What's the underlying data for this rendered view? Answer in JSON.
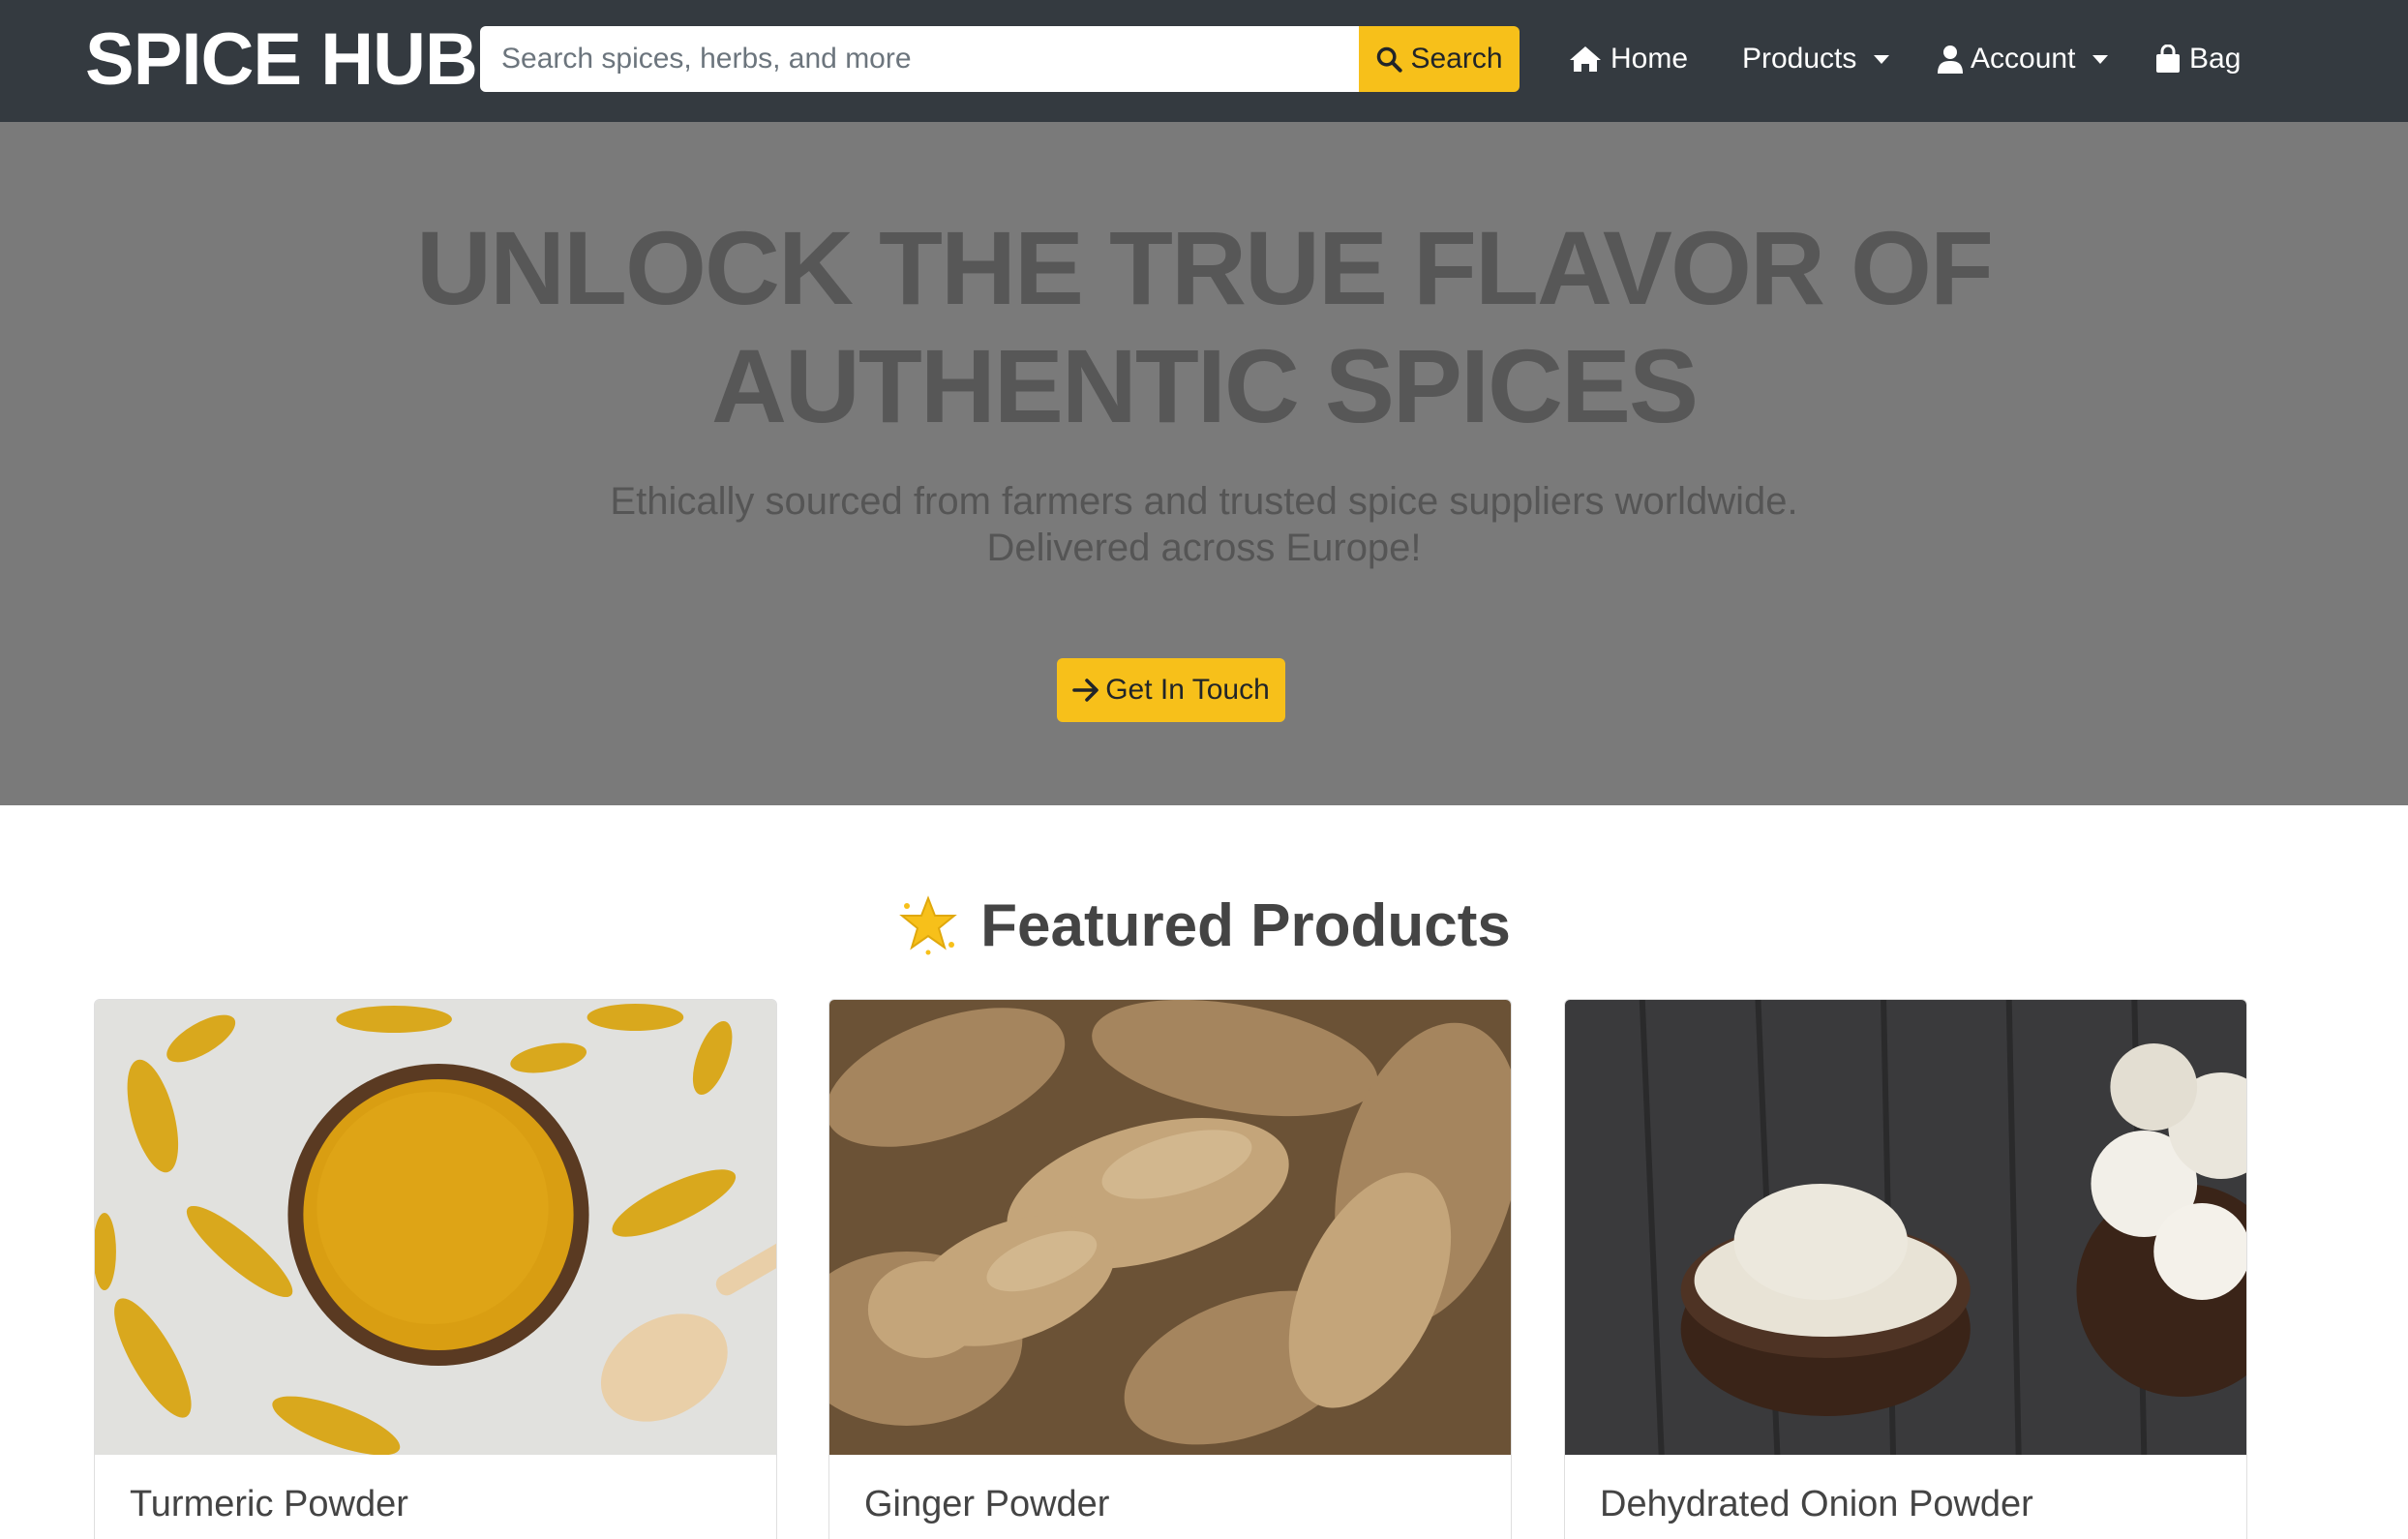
{
  "navbar": {
    "brand": "SPICE HUB",
    "search": {
      "placeholder": "Search spices, herbs, and more",
      "button_label": "Search",
      "icon": "search-icon"
    },
    "links": [
      {
        "label": "Home",
        "icon": "home-icon"
      },
      {
        "label": "Products",
        "icon": "",
        "dropdown": true
      },
      {
        "label": "Account",
        "icon": "user-icon",
        "dropdown": true
      },
      {
        "label": "Bag",
        "icon": "shopping-bag-icon"
      }
    ]
  },
  "hero": {
    "title_line1": "UNLOCK THE TRUE FLAVOR OF",
    "title_line2": "AUTHENTIC SPICES",
    "subtitle_line1": "Ethically sourced from farmers and trusted spice suppliers worldwide.",
    "subtitle_line2": "Delivered across Europe!",
    "cta_label": "Get In Touch",
    "cta_icon": "arrow-right-icon"
  },
  "featured": {
    "heading": "Featured Products",
    "heading_icon": "star-icon",
    "products": [
      {
        "name": "Turmeric Powder"
      },
      {
        "name": "Ginger Powder"
      },
      {
        "name": "Dehydrated Onion Powder"
      }
    ]
  },
  "colors": {
    "navbar_bg": "#343a40",
    "accent": "#f7c01a",
    "hero_bg": "#7a7a7a"
  }
}
